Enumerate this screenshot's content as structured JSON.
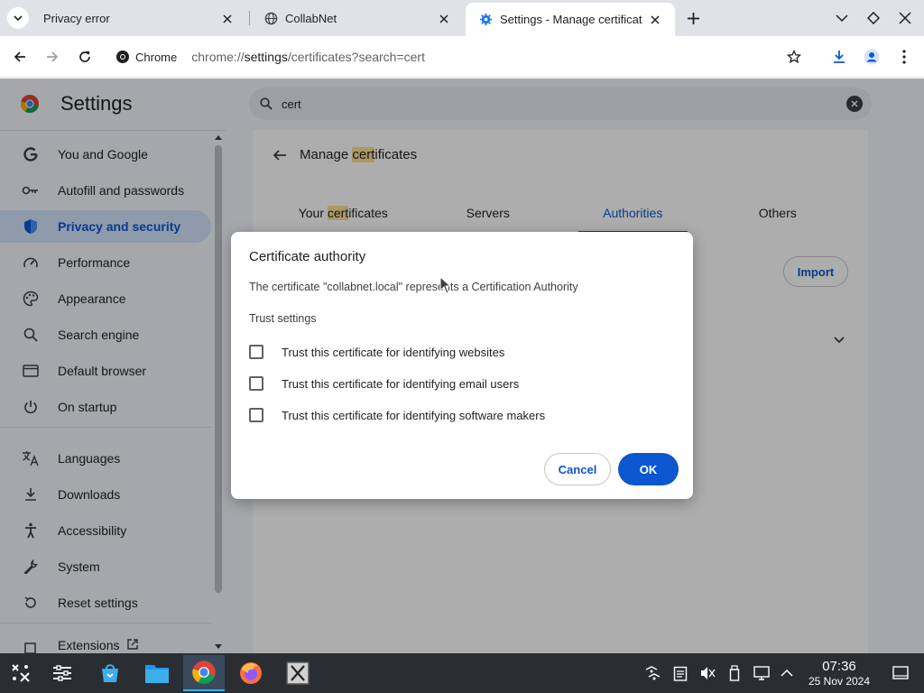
{
  "browser": {
    "tabs": [
      {
        "title": "Privacy error",
        "favicon": "none"
      },
      {
        "title": "CollabNet",
        "favicon": "globe-icon"
      },
      {
        "title": "Settings - Manage certificat",
        "favicon": "gear-icon"
      }
    ],
    "active_tab": 2,
    "chrome_chip": "Chrome",
    "url_prefix": "chrome://",
    "url_host": "settings",
    "url_path": "/certificates?search=cert"
  },
  "settings": {
    "title": "Settings",
    "search_value": "cert",
    "nav": [
      {
        "label": "You and Google",
        "icon": "google-g-icon"
      },
      {
        "label": "Autofill and passwords",
        "icon": "key-icon"
      },
      {
        "label": "Privacy and security",
        "icon": "shield-icon"
      },
      {
        "label": "Performance",
        "icon": "speedometer-icon"
      },
      {
        "label": "Appearance",
        "icon": "palette-icon"
      },
      {
        "label": "Search engine",
        "icon": "search-icon"
      },
      {
        "label": "Default browser",
        "icon": "browser-window-icon"
      },
      {
        "label": "On startup",
        "icon": "power-icon"
      },
      {
        "label": "Languages",
        "icon": "translate-icon"
      },
      {
        "label": "Downloads",
        "icon": "download-icon"
      },
      {
        "label": "Accessibility",
        "icon": "accessibility-icon"
      },
      {
        "label": "System",
        "icon": "wrench-icon"
      },
      {
        "label": "Reset settings",
        "icon": "reset-icon"
      },
      {
        "label": "Extensions",
        "icon": "puzzle-icon"
      }
    ],
    "selected_nav": "Privacy and security",
    "page": {
      "title_pre": "Manage ",
      "title_hl": "cert",
      "title_post": "ificates",
      "tabs": [
        {
          "pre": "Your ",
          "hl": "cert",
          "post": "ificates"
        },
        {
          "pre": "Servers",
          "hl": "",
          "post": ""
        },
        {
          "pre": "Authorities",
          "hl": "",
          "post": ""
        },
        {
          "pre": "Others",
          "hl": "",
          "post": ""
        }
      ],
      "active_tab": "Authorities",
      "import_label": "Import"
    }
  },
  "dialog": {
    "title": "Certificate authority",
    "description": "The certificate \"collabnet.local\" represents a Certification Authority",
    "subtitle": "Trust settings",
    "options": [
      {
        "label": "Trust this certificate for identifying websites",
        "checked": false
      },
      {
        "label": "Trust this certificate for identifying email users",
        "checked": false
      },
      {
        "label": "Trust this certificate for identifying software makers",
        "checked": false
      }
    ],
    "cancel_label": "Cancel",
    "ok_label": "OK"
  },
  "taskbar": {
    "apps": [
      "app-launcher-icon",
      "task-manager-icon",
      "discover-store-icon",
      "file-manager-icon",
      "chrome-icon",
      "firefox-icon",
      "xterm-icon"
    ],
    "active_app": "chrome-icon",
    "clock_time": "07:36",
    "clock_date": "25 Nov 2024"
  },
  "colors": {
    "accent": "#0b57d0",
    "selected_nav_bg": "#d3e3fd",
    "highlight": "#fde293",
    "taskbar": "#2a2e32"
  }
}
